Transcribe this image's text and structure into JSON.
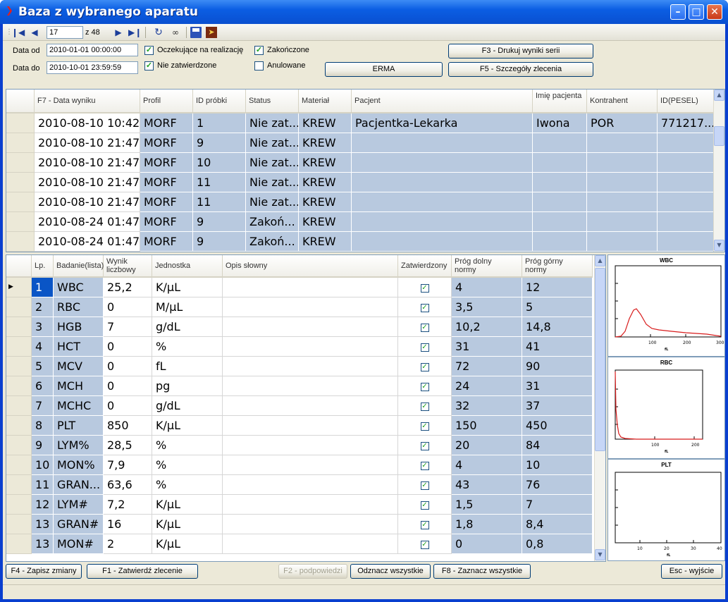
{
  "window": {
    "title": "Baza z wybranego aparatu"
  },
  "toolbar": {
    "position": "17",
    "of_label": "z 48"
  },
  "filter": {
    "date_from_label": "Data od",
    "date_from": "2010-01-01 00:00:00",
    "date_to_label": "Data do",
    "date_to": "2010-10-01 23:59:59",
    "chk_pending": "Oczekujące na realizację",
    "chk_unapproved": "Nie zatwierdzone",
    "chk_finished": "Zakończone",
    "chk_cancelled": "Anulowane",
    "btn_erma": "ERMA",
    "btn_f3": "F3 - Drukuj wyniki serii",
    "btn_f5": "F5 - Szczegóły zlecenia"
  },
  "orders": {
    "headers": [
      "F7 - Data wyniku",
      "Profil",
      "ID próbki",
      "Status",
      "Materiał",
      "Pacjent",
      "Imię pacjenta",
      "Kontrahent",
      "ID(PESEL)"
    ],
    "rows": [
      [
        "2010-08-10 10:42...",
        "MORF",
        "1",
        "Nie zat...",
        "KREW",
        "Pacjentka-Lekarka",
        "Iwona",
        "POR",
        "771217..."
      ],
      [
        "2010-08-10 21:47...",
        "MORF",
        "9",
        "Nie zat...",
        "KREW",
        "",
        "",
        "",
        ""
      ],
      [
        "2010-08-10 21:47...",
        "MORF",
        "10",
        "Nie zat...",
        "KREW",
        "",
        "",
        "",
        ""
      ],
      [
        "2010-08-10 21:47...",
        "MORF",
        "11",
        "Nie zat...",
        "KREW",
        "",
        "",
        "",
        ""
      ],
      [
        "2010-08-10 21:47...",
        "MORF",
        "11",
        "Nie zat...",
        "KREW",
        "",
        "",
        "",
        ""
      ],
      [
        "2010-08-24 01:47...",
        "MORF",
        "9",
        "Zakoń...",
        "KREW",
        "",
        "",
        "",
        ""
      ],
      [
        "2010-08-24 01:47...",
        "MORF",
        "9",
        "Zakoń...",
        "KREW",
        "",
        "",
        "",
        ""
      ]
    ]
  },
  "results": {
    "headers": [
      "Lp.",
      "Badanie(lista)",
      "Wynik liczbowy",
      "Jednostka",
      "Opis słowny",
      "Zatwierdzony",
      "Próg dolny normy",
      "Próg górny normy"
    ],
    "rows": [
      [
        "1",
        "WBC",
        "25,2",
        "K/µL",
        "4",
        "12"
      ],
      [
        "2",
        "RBC",
        "0",
        "M/µL",
        "3,5",
        "5"
      ],
      [
        "3",
        "HGB",
        "7",
        "g/dL",
        "10,2",
        "14,8"
      ],
      [
        "4",
        "HCT",
        "0",
        "%",
        "31",
        "41"
      ],
      [
        "5",
        "MCV",
        "0",
        "fL",
        "72",
        "90"
      ],
      [
        "6",
        "MCH",
        "0",
        "pg",
        "24",
        "31"
      ],
      [
        "7",
        "MCHC",
        "0",
        "g/dL",
        "32",
        "37"
      ],
      [
        "8",
        "PLT",
        "850",
        "K/µL",
        "150",
        "450"
      ],
      [
        "9",
        "LYM%",
        "28,5",
        "%",
        "20",
        "84"
      ],
      [
        "10",
        "MON%",
        "7,9",
        "%",
        "4",
        "10"
      ],
      [
        "11",
        "GRAN...",
        "63,6",
        "%",
        "43",
        "76"
      ],
      [
        "12",
        "LYM#",
        "7,2",
        "K/µL",
        "1,5",
        "7"
      ],
      [
        "13",
        "GRAN#",
        "16",
        "K/µL",
        "1,8",
        "8,4"
      ],
      [
        "13",
        "MON#",
        "2",
        "K/µL",
        "0",
        "0,8"
      ]
    ]
  },
  "histograms": {
    "wbc": {
      "title": "WBC",
      "ticks": [
        "100",
        "200",
        "300"
      ],
      "unit": "fL"
    },
    "rbc": {
      "title": "RBC",
      "ticks": [
        "100",
        "200"
      ],
      "unit": "fL"
    },
    "plt": {
      "title": "PLT",
      "ticks": [
        "10",
        "20",
        "30",
        "40"
      ],
      "unit": "fL"
    }
  },
  "bottom": {
    "f4": "F4 - Zapisz zmiany",
    "f1": "F1 - Zatwierdź zlecenie",
    "f2": "F2 - podpowiedzi",
    "unmark": "Odznacz wszystkie",
    "f8": "F8 - Zaznacz wszystkie",
    "esc": "Esc - wyjście"
  },
  "colors": {
    "selected_row": "#b8c9df",
    "accent": "#0a55c6"
  }
}
